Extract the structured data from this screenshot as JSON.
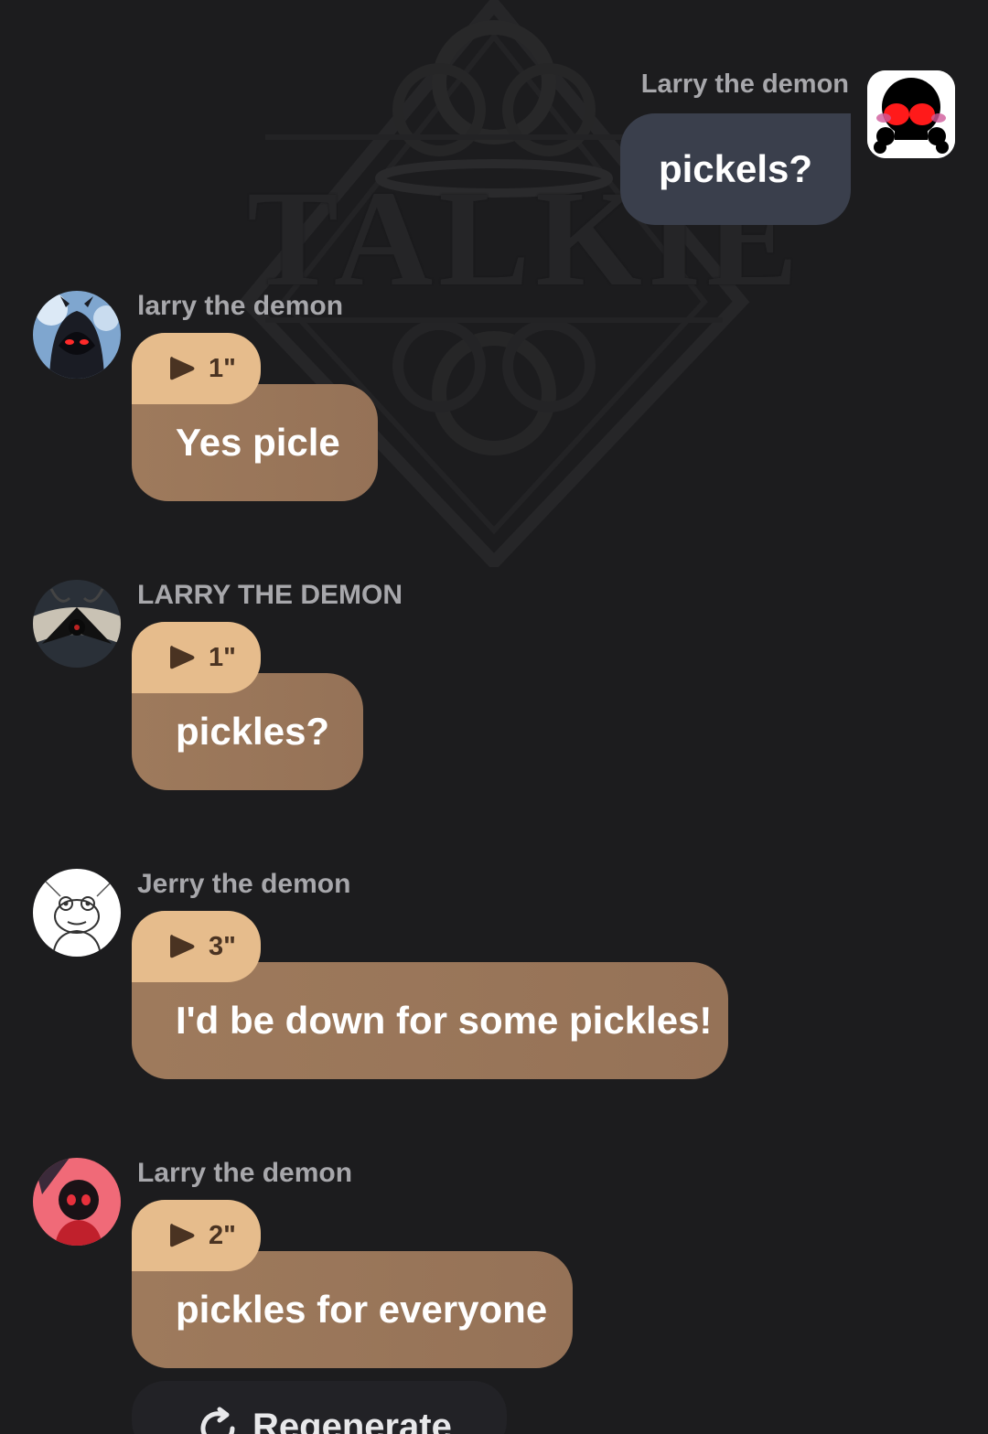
{
  "sent_message": {
    "sender_name": "Larry the demon",
    "text": "pickels?"
  },
  "messages": [
    {
      "sender_name": "larry the demon",
      "audio_duration": "1\"",
      "text": "Yes picle",
      "avatar": "hooded-demon-avatar"
    },
    {
      "sender_name": "LARRY THE DEMON",
      "audio_duration": "1\"",
      "text": "pickles?",
      "avatar": "dark-winged-demon-avatar"
    },
    {
      "sender_name": "Jerry the demon",
      "audio_duration": "3\"",
      "text": "I'd be down for some pickles!",
      "avatar": "frog-sketch-avatar"
    },
    {
      "sender_name": "Larry the demon",
      "audio_duration": "2\"",
      "text": "pickles for everyone",
      "avatar": "red-hooded-demon-avatar"
    }
  ],
  "regenerate_label": "Regenerate",
  "colors": {
    "background": "#1c1c1e",
    "sent_bubble": "#3a3f4c",
    "received_bubble": "#9e7a5c",
    "audio_tag": "#e6bc8c",
    "name_text": "#a7a7ab"
  }
}
